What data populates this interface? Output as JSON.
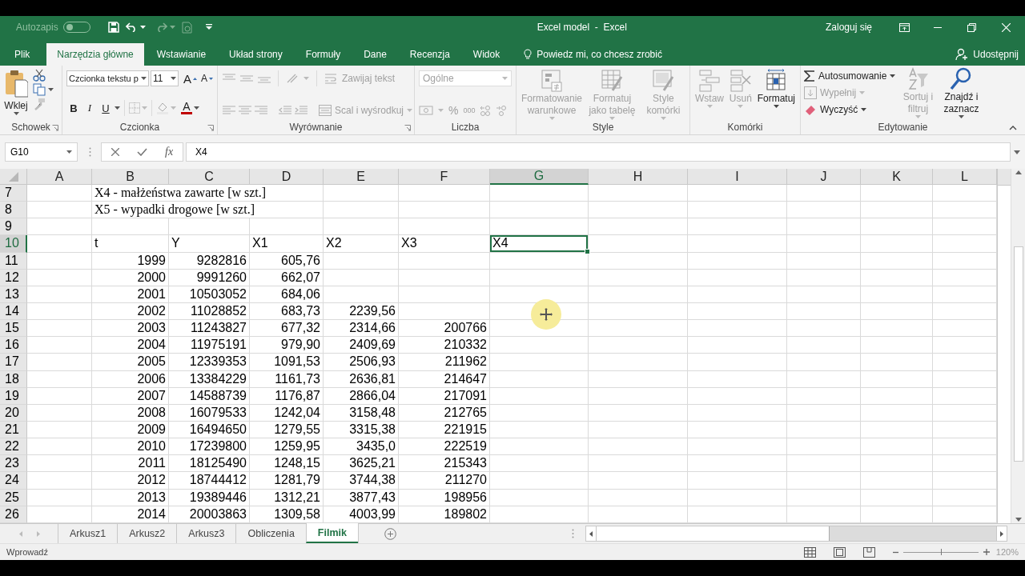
{
  "title_bar": {
    "autosave_label": "Autozapis",
    "autosave_on": false,
    "title": "Excel model  -  Excel",
    "sign_in": "Zaloguj się"
  },
  "menu_tabs": [
    {
      "label": "Plik",
      "selected": false
    },
    {
      "label": "Narzędzia główne",
      "selected": true
    },
    {
      "label": "Wstawianie",
      "selected": false
    },
    {
      "label": "Układ strony",
      "selected": false
    },
    {
      "label": "Formuły",
      "selected": false
    },
    {
      "label": "Dane",
      "selected": false
    },
    {
      "label": "Recenzja",
      "selected": false
    },
    {
      "label": "Widok",
      "selected": false
    }
  ],
  "tell_me": "Powiedz mi, co chcesz zrobić",
  "share": "Udostępnij",
  "ribbon": {
    "clipboard": {
      "label": "Schowek",
      "paste": "Wklej"
    },
    "font": {
      "label": "Czcionka",
      "font_name": "Czcionka tekstu p",
      "font_size": "11",
      "grow": "A",
      "shrink": "A",
      "bold": "B",
      "italic": "I",
      "underline": "U",
      "font_color": "A"
    },
    "alignment": {
      "label": "Wyrównanie",
      "disabled": true,
      "wrap_text": "Zawijaj tekst",
      "merge_center": "Scal i wyśrodkuj"
    },
    "number": {
      "label": "Liczba",
      "disabled": true,
      "format": "Ogólne",
      "percent": "%",
      "thousands": "000"
    },
    "styles": {
      "label": "Style",
      "buttons": [
        {
          "label": "Formatowanie warunkowe",
          "disabled": true
        },
        {
          "label": "Formatuj jako tabelę",
          "disabled": true
        },
        {
          "label": "Style komórki",
          "disabled": true
        }
      ]
    },
    "cells": {
      "label": "Komórki",
      "buttons": [
        {
          "label": "Wstaw",
          "disabled": true
        },
        {
          "label": "Usuń",
          "disabled": true
        },
        {
          "label": "Formatuj",
          "disabled": false
        }
      ]
    },
    "editing": {
      "label": "Edytowanie",
      "items": [
        {
          "label": "Autosumowanie",
          "disabled": false
        },
        {
          "label": "Wypełnij",
          "disabled": true
        },
        {
          "label": "Wyczyść",
          "disabled": false
        }
      ],
      "sort": {
        "label": "Sortuj i filtruj",
        "disabled": true
      },
      "find": {
        "label": "Znajdź i zaznacz",
        "disabled": false
      }
    }
  },
  "formula_bar": {
    "name_box": "G10",
    "fx": "fx",
    "formula": "X4"
  },
  "sheet": {
    "columns": [
      {
        "label": "A",
        "selected": false
      },
      {
        "label": "B",
        "selected": false
      },
      {
        "label": "C",
        "selected": false
      },
      {
        "label": "D",
        "selected": false
      },
      {
        "label": "E",
        "selected": false
      },
      {
        "label": "F",
        "selected": false
      },
      {
        "label": "G",
        "selected": true
      },
      {
        "label": "H",
        "selected": false
      },
      {
        "label": "I",
        "selected": false
      },
      {
        "label": "J",
        "selected": false
      },
      {
        "label": "K",
        "selected": false
      },
      {
        "label": "L",
        "selected": false
      }
    ],
    "rows": [
      {
        "number": "7",
        "selected": false,
        "kind": "note",
        "cells": [
          "",
          "X4 - małżeństwa zawarte [w szt.]"
        ]
      },
      {
        "number": "8",
        "selected": false,
        "kind": "note",
        "cells": [
          "",
          "X5 - wypadki drogowe [w szt.]"
        ]
      },
      {
        "number": "9",
        "selected": false,
        "kind": "data",
        "cells": []
      },
      {
        "number": "10",
        "selected": true,
        "kind": "header",
        "cells": [
          "",
          "t",
          "Y",
          "X1",
          "X2",
          "X3",
          "X4"
        ]
      },
      {
        "number": "11",
        "selected": false,
        "kind": "data",
        "cells": [
          "",
          "1999",
          "9282816",
          "605,76"
        ]
      },
      {
        "number": "12",
        "selected": false,
        "kind": "data",
        "cells": [
          "",
          "2000",
          "9991260",
          "662,07"
        ]
      },
      {
        "number": "13",
        "selected": false,
        "kind": "data",
        "cells": [
          "",
          "2001",
          "10503052",
          "684,06"
        ]
      },
      {
        "number": "14",
        "selected": false,
        "kind": "data",
        "cells": [
          "",
          "2002",
          "11028852",
          "683,73",
          "2239,56"
        ]
      },
      {
        "number": "15",
        "selected": false,
        "kind": "data",
        "cells": [
          "",
          "2003",
          "11243827",
          "677,32",
          "2314,66",
          "200766"
        ]
      },
      {
        "number": "16",
        "selected": false,
        "kind": "data",
        "cells": [
          "",
          "2004",
          "11975191",
          "979,90",
          "2409,69",
          "210332"
        ]
      },
      {
        "number": "17",
        "selected": false,
        "kind": "data",
        "cells": [
          "",
          "2005",
          "12339353",
          "1091,53",
          "2506,93",
          "211962"
        ]
      },
      {
        "number": "18",
        "selected": false,
        "kind": "data",
        "cells": [
          "",
          "2006",
          "13384229",
          "1161,73",
          "2636,81",
          "214647"
        ]
      },
      {
        "number": "19",
        "selected": false,
        "kind": "data",
        "cells": [
          "",
          "2007",
          "14588739",
          "1176,87",
          "2866,04",
          "217091"
        ]
      },
      {
        "number": "20",
        "selected": false,
        "kind": "data",
        "cells": [
          "",
          "2008",
          "16079533",
          "1242,04",
          "3158,48",
          "212765"
        ]
      },
      {
        "number": "21",
        "selected": false,
        "kind": "data",
        "cells": [
          "",
          "2009",
          "16494650",
          "1279,55",
          "3315,38",
          "221915"
        ]
      },
      {
        "number": "22",
        "selected": false,
        "kind": "data",
        "cells": [
          "",
          "2010",
          "17239800",
          "1259,95",
          "3435,0",
          "222519"
        ]
      },
      {
        "number": "23",
        "selected": false,
        "kind": "data",
        "cells": [
          "",
          "2011",
          "18125490",
          "1248,15",
          "3625,21",
          "215343"
        ]
      },
      {
        "number": "24",
        "selected": false,
        "kind": "data",
        "cells": [
          "",
          "2012",
          "18744412",
          "1281,79",
          "3744,38",
          "211270"
        ]
      },
      {
        "number": "25",
        "selected": false,
        "kind": "data",
        "cells": [
          "",
          "2013",
          "19389446",
          "1312,21",
          "3877,43",
          "198956"
        ]
      },
      {
        "number": "26",
        "selected": false,
        "kind": "data",
        "cells": [
          "",
          "2014",
          "20003863",
          "1309,58",
          "4003,99",
          "189802"
        ]
      }
    ]
  },
  "sheet_tabs": [
    {
      "label": "Arkusz1",
      "selected": false
    },
    {
      "label": "Arkusz2",
      "selected": false
    },
    {
      "label": "Arkusz3",
      "selected": false
    },
    {
      "label": "Obliczenia",
      "selected": false
    },
    {
      "label": "Filmik",
      "selected": true
    }
  ],
  "status_bar": {
    "mode": "Wprowadź",
    "zoom": "120%",
    "zoom_slider": {
      "level": 0.5
    }
  }
}
